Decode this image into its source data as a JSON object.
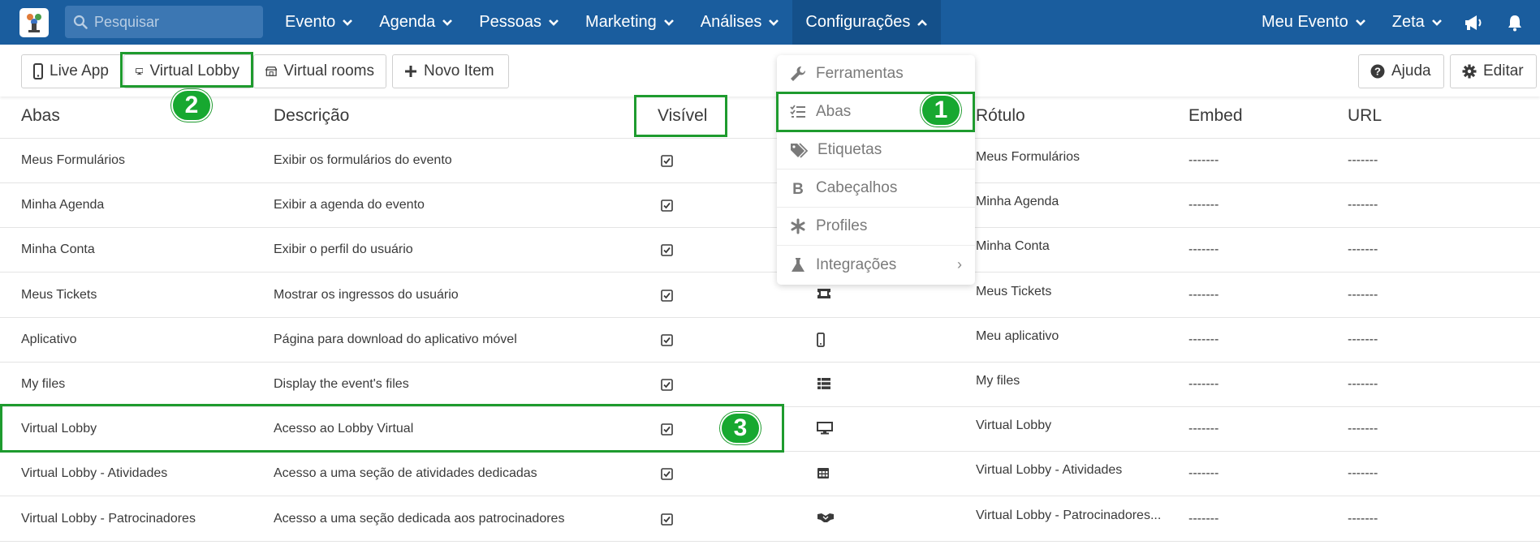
{
  "topbar": {
    "search_placeholder": "Pesquisar",
    "nav": [
      "Evento",
      "Agenda",
      "Pessoas",
      "Marketing",
      "Análises",
      "Configurações"
    ],
    "right_nav": [
      "Meu Evento",
      "Zeta"
    ]
  },
  "toolbar": {
    "live_app": "Live App",
    "virtual_lobby": "Virtual Lobby",
    "virtual_rooms": "Virtual rooms",
    "novo_item": "Novo Item",
    "ajuda": "Ajuda",
    "editar": "Editar"
  },
  "table": {
    "headers": [
      "Abas",
      "Descrição",
      "Visível",
      "Rótulo",
      "Embed",
      "URL"
    ],
    "rows": [
      {
        "aba": "Meus Formulários",
        "descricao": "Exibir os formulários do evento",
        "rotulo": "Meus Formulários",
        "embed": "-------",
        "url": "-------",
        "icon": "form-icon"
      },
      {
        "aba": "Minha Agenda",
        "descricao": "Exibir a agenda do evento",
        "rotulo": "Minha Agenda",
        "embed": "-------",
        "url": "-------",
        "icon": "calendar-icon"
      },
      {
        "aba": "Minha Conta",
        "descricao": "Exibir o perfil do usuário",
        "rotulo": "Minha Conta",
        "embed": "-------",
        "url": "-------",
        "icon": "user-icon"
      },
      {
        "aba": "Meus Tickets",
        "descricao": "Mostrar os ingressos do usuário",
        "rotulo": "Meus Tickets",
        "embed": "-------",
        "url": "-------",
        "icon": "ticket-icon"
      },
      {
        "aba": "Aplicativo",
        "descricao": "Página para download do aplicativo móvel",
        "rotulo": "Meu aplicativo",
        "embed": "-------",
        "url": "-------",
        "icon": "mobile-icon"
      },
      {
        "aba": "My files",
        "descricao": "Display the event's files",
        "rotulo": "My files",
        "embed": "-------",
        "url": "-------",
        "icon": "list-icon"
      },
      {
        "aba": "Virtual Lobby",
        "descricao": "Acesso ao Lobby Virtual",
        "rotulo": "Virtual Lobby",
        "embed": "-------",
        "url": "-------",
        "icon": "desktop-icon"
      },
      {
        "aba": "Virtual Lobby - Atividades",
        "descricao": "Acesso a uma seção de atividades dedicadas",
        "rotulo": "Virtual Lobby - Atividades",
        "embed": "-------",
        "url": "-------",
        "icon": "calendar-icon"
      },
      {
        "aba": "Virtual Lobby - Patrocinadores",
        "descricao": "Acesso a uma seção dedicada aos patrocinadores",
        "rotulo": "Virtual Lobby - Patrocinadores...",
        "embed": "-------",
        "url": "-------",
        "icon": "handshake-icon"
      }
    ]
  },
  "dropdown": {
    "items": [
      "Ferramentas",
      "Abas",
      "Etiquetas",
      "Cabeçalhos",
      "Profiles",
      "Integrações"
    ],
    "submenu_arrow": "›"
  },
  "annotations": {
    "badge_1": "1",
    "badge_2": "2",
    "badge_3": "3",
    "highlight_color": "#1e9b2e"
  },
  "colors": {
    "topbar": "#1a5d9e",
    "active_nav": "#14508a"
  }
}
